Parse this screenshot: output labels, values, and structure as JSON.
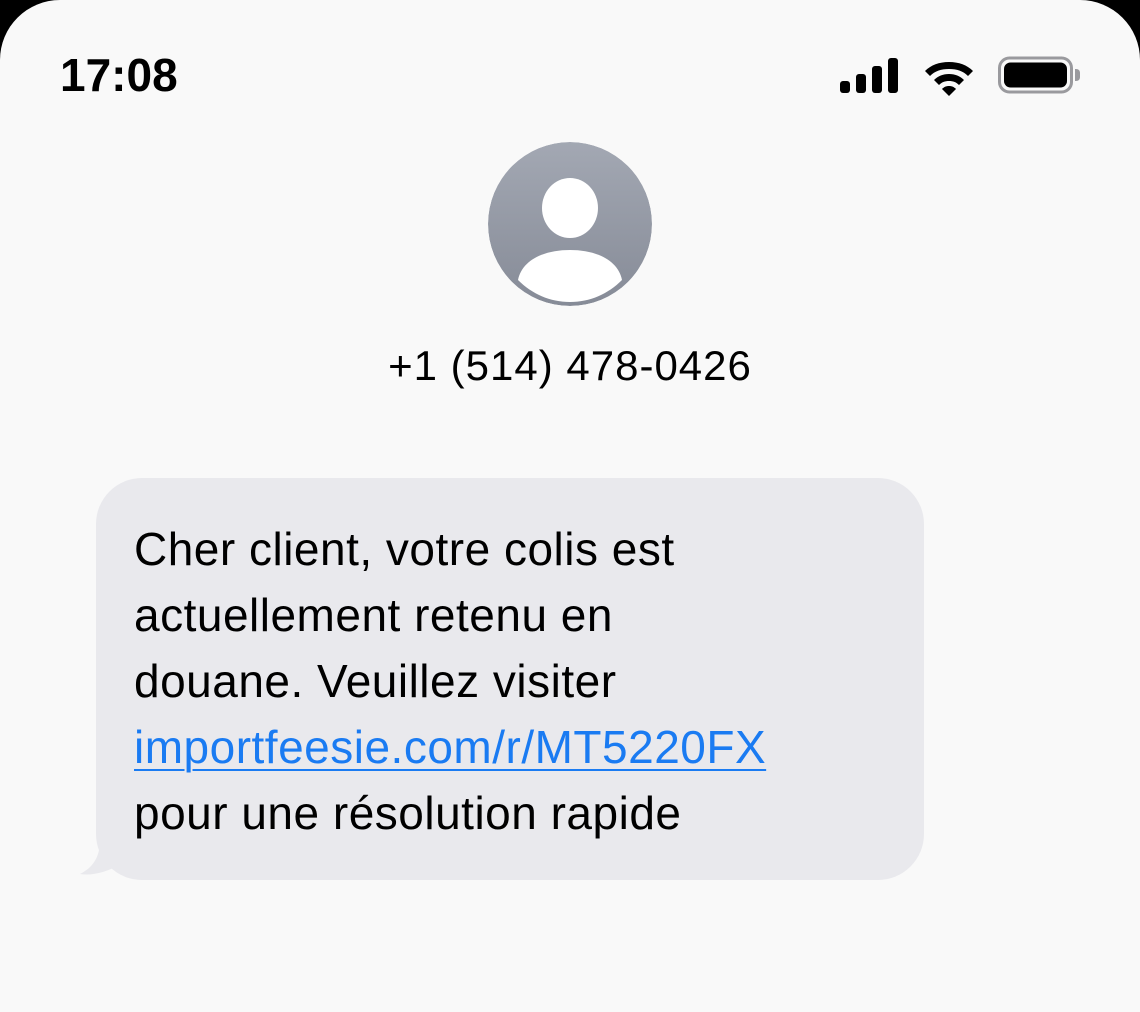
{
  "status_bar": {
    "time": "17:08",
    "icons": [
      "signal-icon",
      "wifi-icon",
      "battery-icon"
    ]
  },
  "contact": {
    "avatar_icon": "person-icon",
    "name": "+1 (514) 478-0426"
  },
  "message": {
    "lines": [
      "Cher client, votre colis est",
      "actuellement retenu en",
      "douane. Veuillez visiter"
    ],
    "link_text": "importfeesie.com/r/MT5220FX",
    "after_link": "pour une résolution rapide"
  },
  "colors": {
    "background": "#f9f9f9",
    "bubble": "#e9e9ed",
    "link": "#1a7bf2",
    "avatar_gradient_top": "#a3a8b3",
    "avatar_gradient_bottom": "#868b97"
  }
}
